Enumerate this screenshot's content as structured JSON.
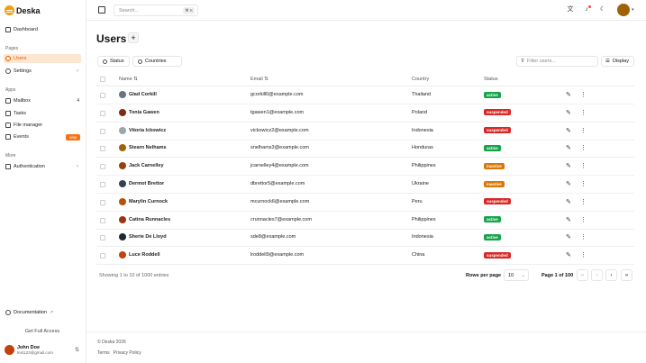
{
  "app": {
    "name": "Deska"
  },
  "sidebar": {
    "sections": [
      {
        "label": "Pages"
      },
      {
        "label": "Apps"
      },
      {
        "label": "More"
      }
    ],
    "dashboard": "Dashboard",
    "users": "Users",
    "settings": "Settings",
    "mailbox": "Mailbox",
    "mailbox_count": "4",
    "tasks": "Tasks",
    "file_manager": "File manager",
    "events": "Events",
    "events_badge": "new",
    "authentication": "Authentication",
    "documentation": "Documentation",
    "get_access": "Get Full Access",
    "user": {
      "name": "John Doe",
      "email": "test123@gmail.com"
    }
  },
  "topbar": {
    "search_placeholder": "Search...",
    "search_shortcut": "⌘ K"
  },
  "page": {
    "title": "Users",
    "filters": {
      "status": "Status",
      "countries": "Countries"
    },
    "filter_placeholder": "Filter users...",
    "display": "Display"
  },
  "table": {
    "columns": {
      "name": "Name",
      "email": "Email",
      "country": "Country",
      "status": "Status"
    },
    "rows": [
      {
        "name": "Glad Corkill",
        "email": "gcorkill0@example.com",
        "country": "Thailand",
        "status": "active"
      },
      {
        "name": "Tonia Gawen",
        "email": "tgawen1@example.com",
        "country": "Poland",
        "status": "suspended"
      },
      {
        "name": "Vitoria Ickowicz",
        "email": "vickowicz2@example.com",
        "country": "Indonesia",
        "status": "suspended"
      },
      {
        "name": "Stearn Nelhams",
        "email": "snelhams3@example.com",
        "country": "Honduras",
        "status": "active"
      },
      {
        "name": "Jack Carnelley",
        "email": "jcarnelley4@example.com",
        "country": "Philippines",
        "status": "inactive"
      },
      {
        "name": "Dermot Brettor",
        "email": "dbrettor5@example.com",
        "country": "Ukraine",
        "status": "inactive"
      },
      {
        "name": "Marylin Curnock",
        "email": "mcurnock6@example.com",
        "country": "Peru",
        "status": "suspended"
      },
      {
        "name": "Catina Runnacles",
        "email": "crunnacles7@example.com",
        "country": "Philippines",
        "status": "active"
      },
      {
        "name": "Sherie De Lloyd",
        "email": "sde8@example.com",
        "country": "Indonesia",
        "status": "active"
      },
      {
        "name": "Luce Roddell",
        "email": "lroddell9@example.com",
        "country": "China",
        "status": "suspended"
      }
    ]
  },
  "pagination": {
    "showing": "Showing 1 to 10 of 1000 entries",
    "rows_per_page_label": "Rows per page",
    "rows_per_page": "10",
    "page_info": "Page 1 of 100"
  },
  "footer": {
    "copyright": "© Deska 2026",
    "terms": "Terms",
    "privacy": "Privacy Policy"
  },
  "colors": {
    "accent": "#e65a00",
    "active": "#16a34a",
    "suspended": "#dc2626",
    "inactive": "#d97706"
  }
}
